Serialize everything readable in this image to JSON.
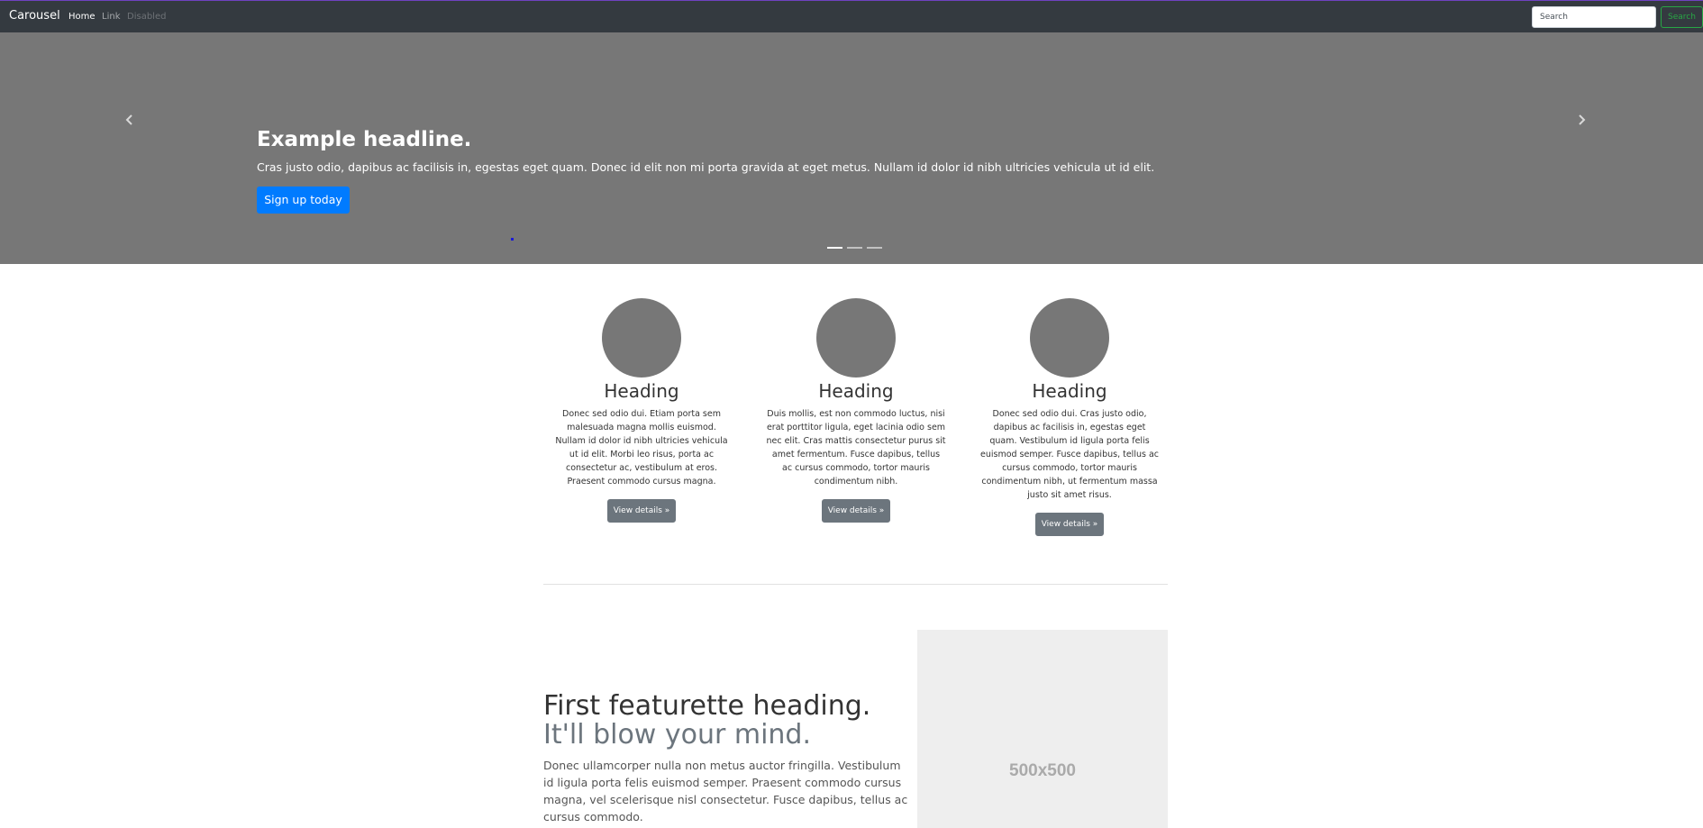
{
  "navbar": {
    "brand": "Carousel",
    "links": [
      {
        "label": "Home",
        "state": "active"
      },
      {
        "label": "Link",
        "state": "normal"
      },
      {
        "label": "Disabled",
        "state": "disabled"
      }
    ],
    "search": {
      "placeholder": "Search",
      "button_label": "Search"
    }
  },
  "carousel": {
    "prev_icon": "chevron-left-icon",
    "next_icon": "chevron-right-icon",
    "slide": {
      "headline": "Example headline.",
      "lead": "Cras justo odio, dapibus ac facilisis in, egestas eget quam. Donec id elit non mi porta gravida at eget metus. Nullam id dolor id nibh ultricies vehicula ut id elit.",
      "cta_label": "Sign up today"
    },
    "indicators_count": 3,
    "active_indicator": 1
  },
  "marketing": [
    {
      "heading": "Heading",
      "text": "Donec sed odio dui. Etiam porta sem malesuada magna mollis euismod. Nullam id dolor id nibh ultricies vehicula ut id elit. Morbi leo risus, porta ac consectetur ac, vestibulum at eros. Praesent commodo cursus magna.",
      "button_label": "View details »"
    },
    {
      "heading": "Heading",
      "text": "Duis mollis, est non commodo luctus, nisi erat porttitor ligula, eget lacinia odio sem nec elit. Cras mattis consectetur purus sit amet fermentum. Fusce dapibus, tellus ac cursus commodo, tortor mauris condimentum nibh.",
      "button_label": "View details »"
    },
    {
      "heading": "Heading",
      "text": "Donec sed odio dui. Cras justo odio, dapibus ac facilisis in, egestas eget quam. Vestibulum id ligula porta felis euismod semper. Fusce dapibus, tellus ac cursus commodo, tortor mauris condimentum nibh, ut fermentum massa justo sit amet risus.",
      "button_label": "View details »"
    }
  ],
  "featurette": {
    "heading": "First featurette heading.",
    "heading_muted": "It'll blow your mind.",
    "text": "Donec ullamcorper nulla non metus auctor fringilla. Vestibulum id ligula porta felis euismod semper. Praesent commodo cursus magna, vel scelerisque nisl consectetur. Fusce dapibus, tellus ac cursus commodo.",
    "image_label": "500x500"
  },
  "colors": {
    "navbar_bg": "#343a40",
    "carousel_bg": "#777777",
    "primary": "#007bff",
    "success": "#28a745",
    "secondary": "#6c757d",
    "placeholder_bg": "#eeeeee"
  }
}
